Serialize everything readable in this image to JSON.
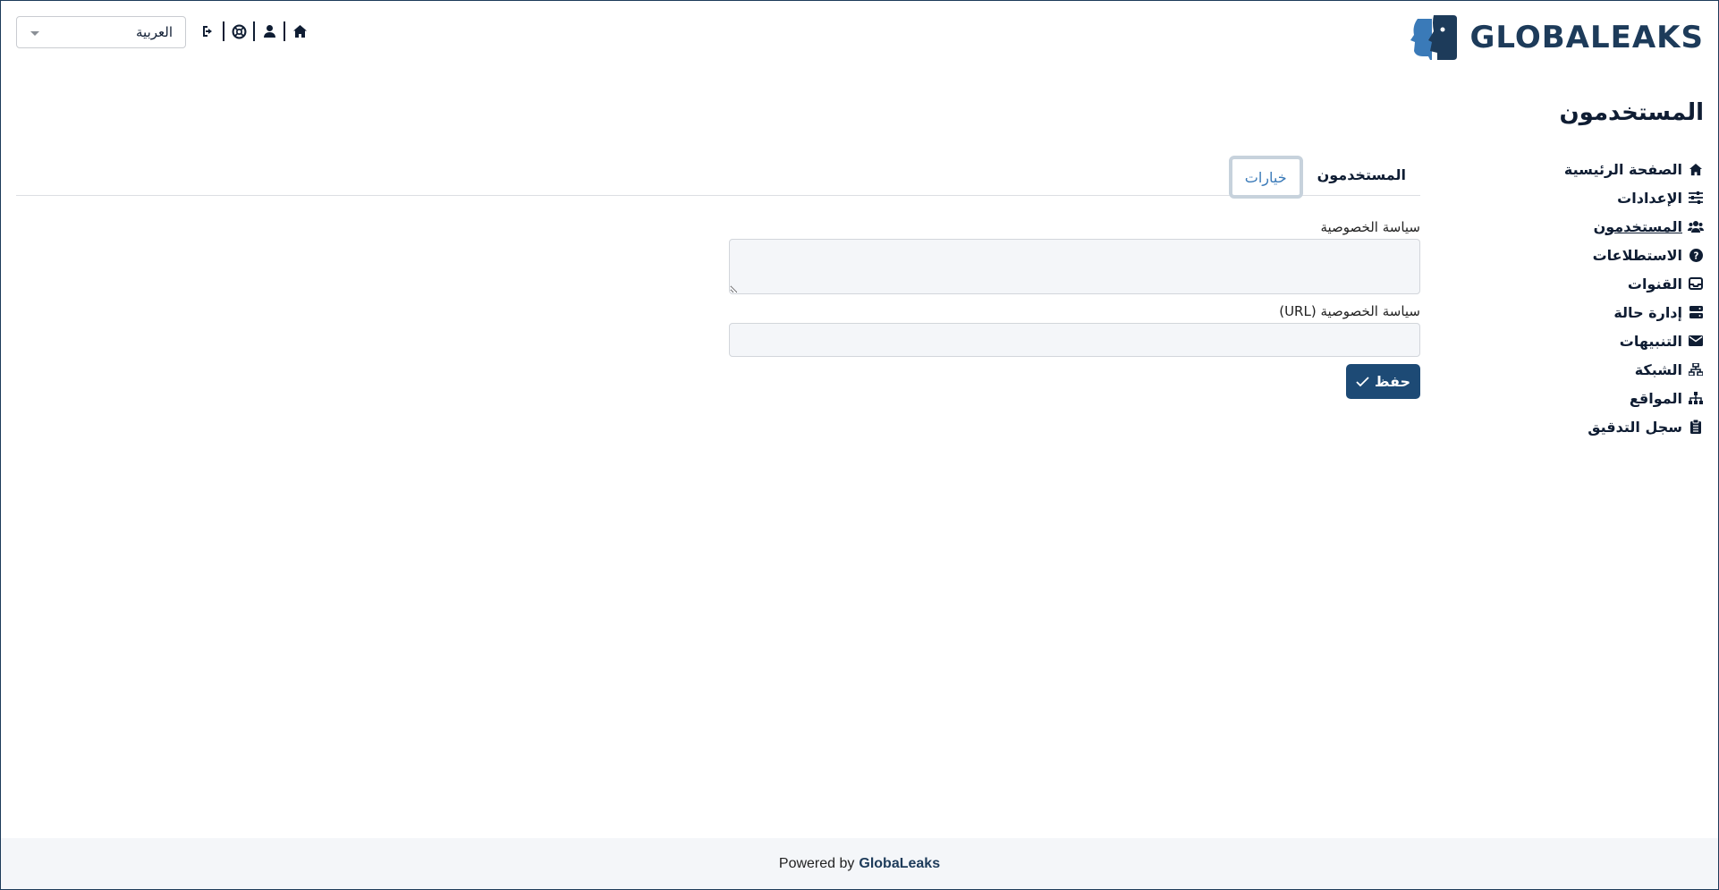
{
  "header": {
    "logo_text": "GLOBALEAKS",
    "language": {
      "selected": "العربية"
    },
    "toolbar_icons": [
      "logout-icon",
      "support-icon",
      "user-icon",
      "home-icon"
    ]
  },
  "page": {
    "title": "المستخدمون"
  },
  "sidebar": {
    "items": [
      {
        "label": "الصفحة الرئيسية",
        "icon": "home-icon"
      },
      {
        "label": "الإعدادات",
        "icon": "sliders-icon"
      },
      {
        "label": "المستخدمون",
        "icon": "users-icon",
        "active": true
      },
      {
        "label": "الاستطلاعات",
        "icon": "question-circle-icon"
      },
      {
        "label": "القنوات",
        "icon": "inbox-icon"
      },
      {
        "label": "إدارة حالة",
        "icon": "server-icon"
      },
      {
        "label": "التنبيهات",
        "icon": "envelope-icon"
      },
      {
        "label": "الشبكة",
        "icon": "network-icon"
      },
      {
        "label": "المواقع",
        "icon": "sitemap-icon"
      },
      {
        "label": "سجل التدقيق",
        "icon": "clipboard-icon"
      }
    ]
  },
  "tabs": [
    {
      "label": "المستخدمون",
      "active": false
    },
    {
      "label": "خيارات",
      "active": true
    }
  ],
  "form": {
    "privacy_policy_label": "سياسة الخصوصية",
    "privacy_policy_value": "",
    "privacy_policy_url_label": "سياسة الخصوصية (URL)",
    "privacy_policy_url_value": "",
    "save_label": "حفظ"
  },
  "footer": {
    "prefix": "Powered by",
    "brand": "GlobaLeaks"
  },
  "colors": {
    "primary": "#1d4a75",
    "text": "#0f1d33",
    "tab_active": "#3a7ab8",
    "footer_bg": "#f4f6f9"
  }
}
